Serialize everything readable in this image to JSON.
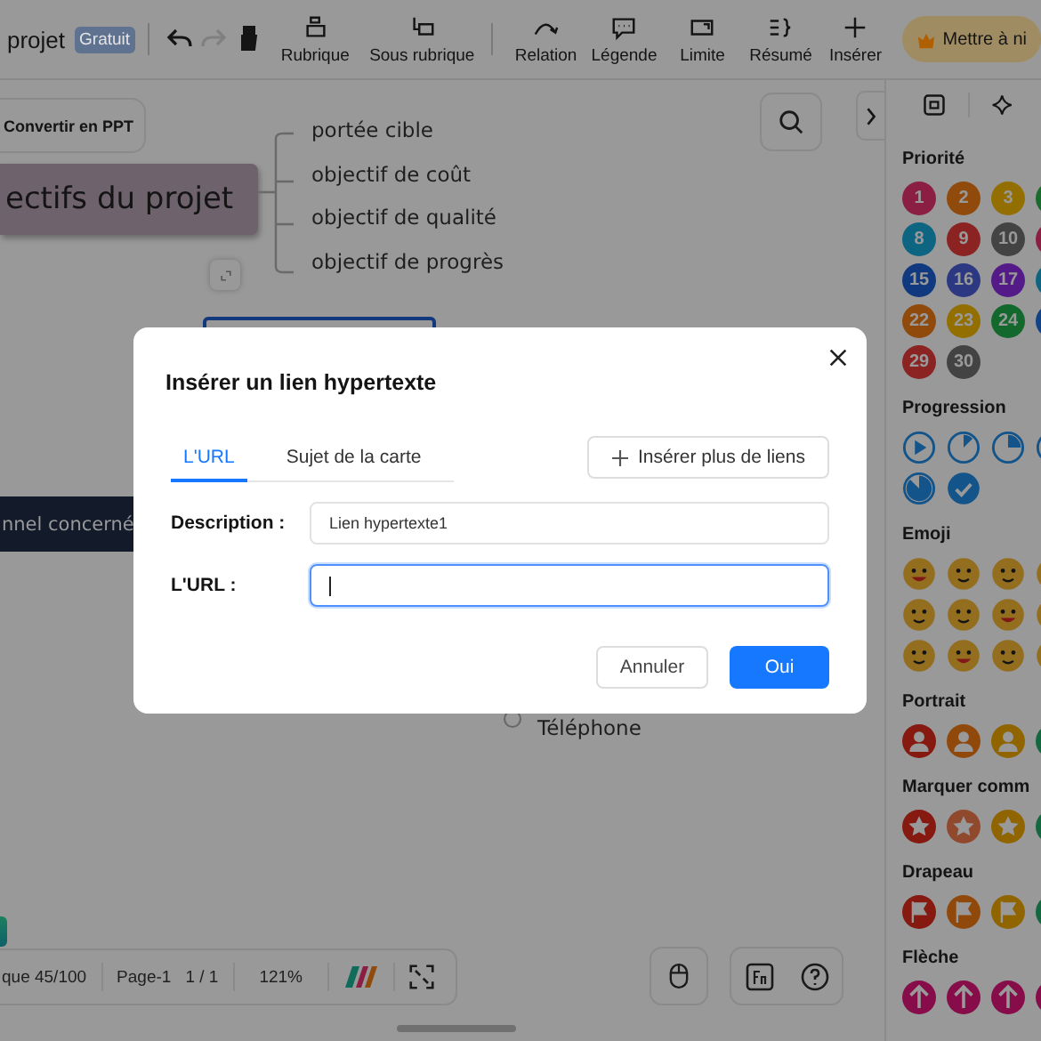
{
  "toolbar": {
    "doc_title": "projet",
    "badge": "Gratuit",
    "undo": {
      "disabled": false
    },
    "redo": {
      "disabled": true
    },
    "tools": [
      {
        "label": "Rubrique"
      },
      {
        "label": "Sous rubrique"
      },
      {
        "label": "Relation"
      },
      {
        "label": "Légende"
      },
      {
        "label": "Limite"
      },
      {
        "label": "Résumé"
      },
      {
        "label": "Insérer"
      }
    ],
    "premium_button": "Mettre à ni"
  },
  "canvas": {
    "convert_button": "Convertir en PPT",
    "central_topic": "ectifs du projet",
    "branches": [
      "portée cible",
      "objectif de coût",
      "objectif de qualité",
      "objectif de progrès"
    ],
    "side_topic": "nnel concerné",
    "sub_topic": "Téléphone"
  },
  "status_bar": {
    "topic_count": "que 45/100",
    "page": "Page-1",
    "page_count": "1 / 1",
    "zoom": "121%"
  },
  "panel": {
    "sections": [
      {
        "kind": "priority",
        "title": "Priorité",
        "items": [
          {
            "label": "1",
            "color": "#8b1f43"
          },
          {
            "label": "2",
            "color": "#904a0b"
          },
          {
            "label": "3",
            "color": "#936e00"
          },
          {
            "color": "#1a6b2e"
          },
          {
            "label": "8",
            "color": "#0d6582"
          },
          {
            "label": "9",
            "color": "#8b2323"
          },
          {
            "label": "10",
            "color": "#434343"
          },
          {
            "color": "#8b1f43"
          },
          {
            "label": "15",
            "color": "#113980"
          },
          {
            "label": "16",
            "color": "#2c3982"
          },
          {
            "label": "17",
            "color": "#531a88"
          },
          {
            "color": "#0d6582"
          },
          {
            "label": "22",
            "color": "#904a0b"
          },
          {
            "label": "23",
            "color": "#936e00"
          },
          {
            "label": "24",
            "color": "#13682d"
          },
          {
            "color": "#114386"
          },
          {
            "label": "29",
            "color": "#8b2323"
          },
          {
            "label": "30",
            "color": "#434343"
          }
        ]
      },
      {
        "kind": "progress",
        "title": "Progression"
      },
      {
        "kind": "emoji",
        "title": "Emoji"
      },
      {
        "kind": "portrait",
        "title": "Portrait",
        "items": [
          {
            "color": "#861910"
          },
          {
            "color": "#90490b"
          },
          {
            "color": "#906500"
          },
          {
            "color": "#136840"
          }
        ]
      },
      {
        "kind": "star",
        "title": "Marquer comm",
        "items": [
          {
            "color": "#861910"
          },
          {
            "color": "#90492c"
          },
          {
            "color": "#906500"
          },
          {
            "color": "#136840"
          }
        ]
      },
      {
        "kind": "flag",
        "title": "Drapeau",
        "items": [
          {
            "color": "#861910"
          },
          {
            "color": "#90490b"
          },
          {
            "color": "#906500"
          },
          {
            "color": "#136840"
          }
        ]
      },
      {
        "kind": "arrow",
        "title": "Flèche",
        "items": [
          {
            "color": "#860d49"
          },
          {
            "color": "#860d49"
          },
          {
            "color": "#860d49"
          },
          {
            "color": "#860d49"
          }
        ]
      }
    ]
  },
  "dialog": {
    "title": "Insérer un lien hypertexte",
    "tabs": [
      {
        "label": "L'URL",
        "selected": true
      },
      {
        "label": "Sujet de la carte",
        "selected": false
      }
    ],
    "add_button": "Insérer plus de liens",
    "fields": [
      {
        "label": "Description :",
        "value": "Lien hypertexte1",
        "focused": false
      },
      {
        "label": "L'URL :",
        "focused": true
      }
    ],
    "buttons": [
      {
        "label": "Annuler",
        "kind": "secondary"
      },
      {
        "label": "Oui",
        "kind": "primary"
      }
    ]
  }
}
